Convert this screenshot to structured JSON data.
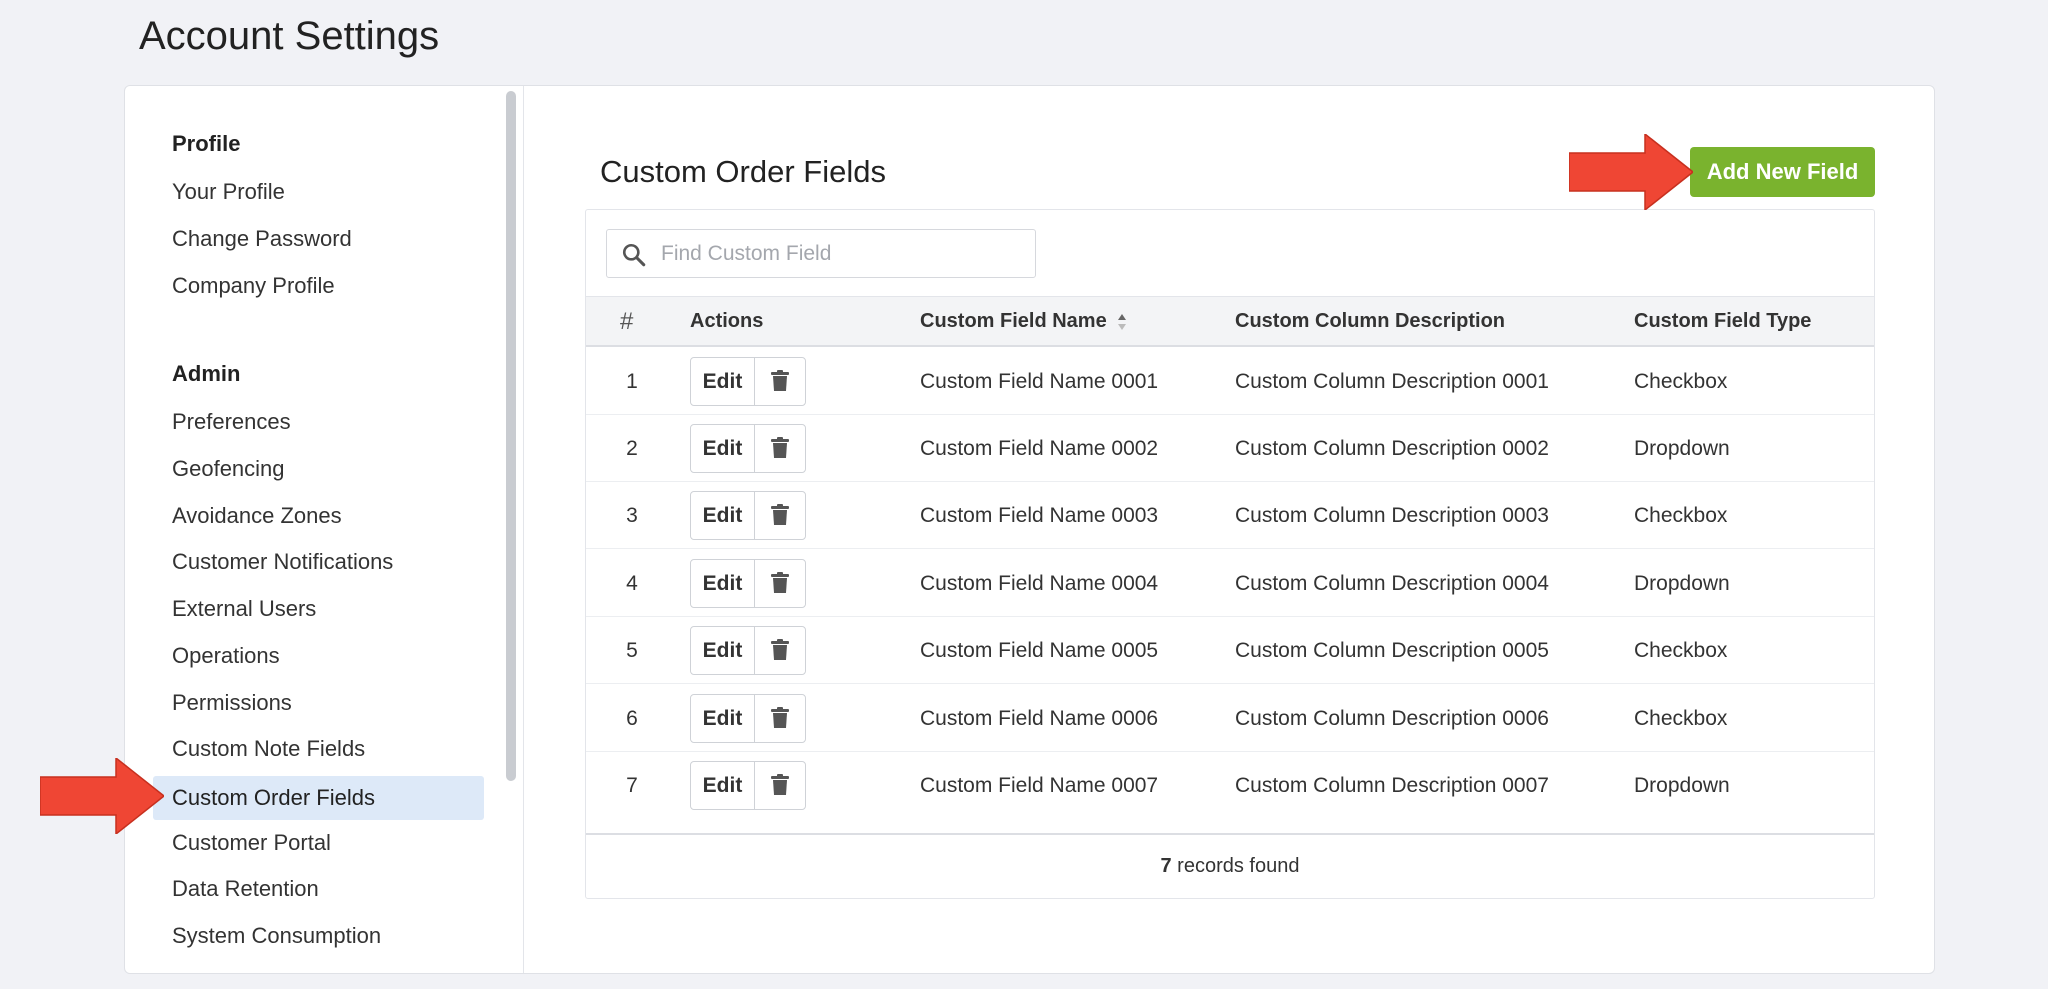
{
  "page": {
    "title": "Account Settings"
  },
  "sidebar": {
    "profile_heading": "Profile",
    "profile_items": [
      {
        "label": "Your Profile"
      },
      {
        "label": "Change Password"
      },
      {
        "label": "Company Profile"
      }
    ],
    "admin_heading": "Admin",
    "admin_items": [
      {
        "label": "Preferences"
      },
      {
        "label": "Geofencing"
      },
      {
        "label": "Avoidance Zones"
      },
      {
        "label": "Customer Notifications"
      },
      {
        "label": "External Users"
      },
      {
        "label": "Operations"
      },
      {
        "label": "Permissions"
      },
      {
        "label": "Custom Note Fields"
      },
      {
        "label": "Custom Order Fields"
      },
      {
        "label": "Customer Portal"
      },
      {
        "label": "Data Retention"
      },
      {
        "label": "System Consumption"
      }
    ],
    "active_item": "Custom Order Fields"
  },
  "main": {
    "title": "Custom Order Fields",
    "add_button_label": "Add New Field",
    "search": {
      "placeholder": "Find Custom Field",
      "value": ""
    },
    "columns": {
      "number": "#",
      "actions": "Actions",
      "name": "Custom Field Name",
      "description": "Custom Column Description",
      "type": "Custom Field Type"
    },
    "edit_label": "Edit",
    "rows": [
      {
        "num": "1",
        "name": "Custom Field Name 0001",
        "description": "Custom Column Description 0001",
        "type": "Checkbox"
      },
      {
        "num": "2",
        "name": "Custom Field Name 0002",
        "description": "Custom Column Description 0002",
        "type": "Dropdown"
      },
      {
        "num": "3",
        "name": "Custom Field Name 0003",
        "description": "Custom Column Description 0003",
        "type": "Checkbox"
      },
      {
        "num": "4",
        "name": "Custom Field Name 0004",
        "description": "Custom Column Description 0004",
        "type": "Dropdown"
      },
      {
        "num": "5",
        "name": "Custom Field Name 0005",
        "description": "Custom Column Description 0005",
        "type": "Checkbox"
      },
      {
        "num": "6",
        "name": "Custom Field Name 0006",
        "description": "Custom Column Description 0006",
        "type": "Checkbox"
      },
      {
        "num": "7",
        "name": "Custom Field Name 0007",
        "description": "Custom Column Description 0007",
        "type": "Dropdown"
      }
    ],
    "footer": {
      "count": "7",
      "text": " records found"
    }
  },
  "colors": {
    "accent_green": "#7ab32e",
    "annotation_arrow": "#ef4634",
    "active_item_bg": "#dde9f8"
  },
  "icons": {
    "search": "search-icon",
    "delete": "trash-icon",
    "sort": "sort-icon",
    "annotation": "arrow-pointer-icon"
  }
}
